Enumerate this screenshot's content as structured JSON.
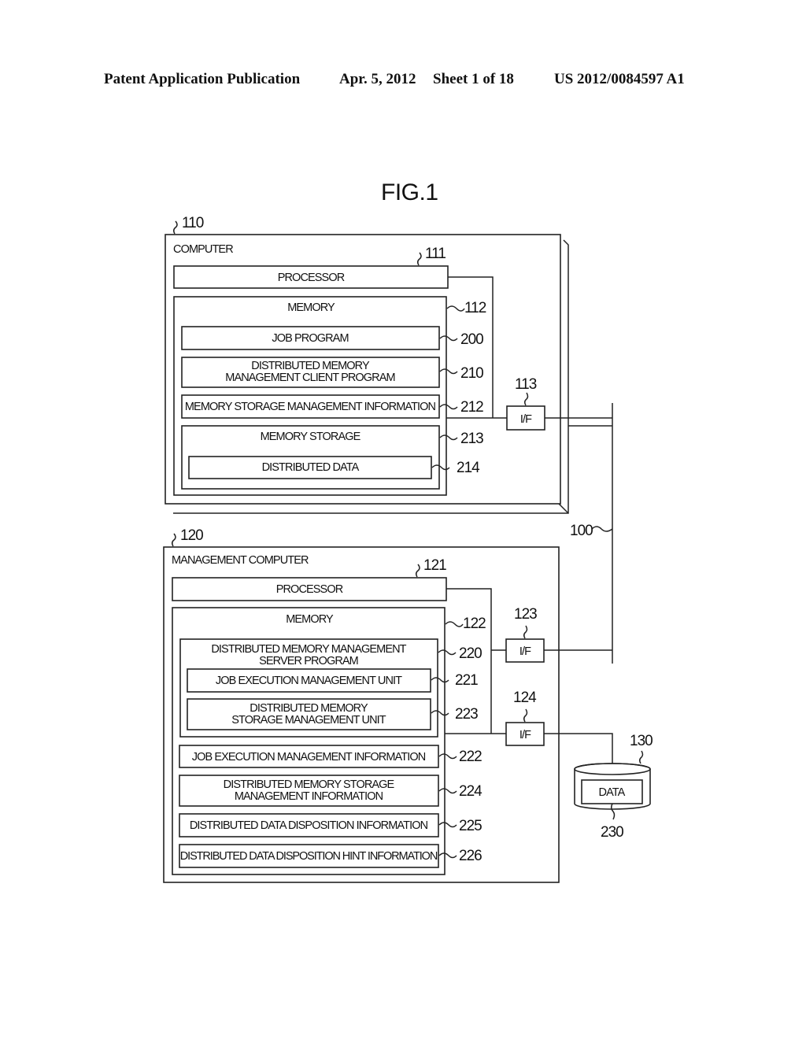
{
  "header": {
    "publication": "Patent Application Publication",
    "date": "Apr. 5, 2012",
    "sheet": "Sheet 1 of 18",
    "number": "US 2012/0084597 A1"
  },
  "figure": {
    "title": "FIG.1",
    "network_ref": "100",
    "computer": {
      "ref": "110",
      "title": "COMPUTER",
      "processor": {
        "ref": "111",
        "label": "PROCESSOR"
      },
      "memory": {
        "ref": "112",
        "label": "MEMORY",
        "items": [
          {
            "ref": "200",
            "lines": [
              "JOB PROGRAM"
            ]
          },
          {
            "ref": "210",
            "lines": [
              "DISTRIBUTED MEMORY",
              "MANAGEMENT CLIENT PROGRAM"
            ]
          },
          {
            "ref": "212",
            "lines": [
              "MEMORY STORAGE MANAGEMENT INFORMATION"
            ]
          }
        ],
        "storage": {
          "ref": "213",
          "label": "MEMORY STORAGE",
          "data": {
            "ref": "214",
            "label": "DISTRIBUTED DATA"
          }
        }
      },
      "interface": {
        "ref": "113",
        "label": "I/F"
      }
    },
    "management_computer": {
      "ref": "120",
      "title": "MANAGEMENT COMPUTER",
      "processor": {
        "ref": "121",
        "label": "PROCESSOR"
      },
      "memory": {
        "ref": "122",
        "label": "MEMORY",
        "server_program": {
          "ref": "220",
          "lines": [
            "DISTRIBUTED MEMORY MANAGEMENT",
            "SERVER PROGRAM"
          ],
          "units": [
            {
              "ref": "221",
              "lines": [
                "JOB EXECUTION MANAGEMENT UNIT"
              ]
            },
            {
              "ref": "223",
              "lines": [
                "DISTRIBUTED MEMORY",
                "STORAGE MANAGEMENT UNIT"
              ]
            }
          ]
        },
        "items": [
          {
            "ref": "222",
            "lines": [
              "JOB EXECUTION MANAGEMENT INFORMATION"
            ]
          },
          {
            "ref": "224",
            "lines": [
              "DISTRIBUTED MEMORY STORAGE",
              "MANAGEMENT INFORMATION"
            ]
          },
          {
            "ref": "225",
            "lines": [
              "DISTRIBUTED DATA DISPOSITION INFORMATION"
            ]
          },
          {
            "ref": "226",
            "lines": [
              "DISTRIBUTED DATA DISPOSITION HINT INFORMATION"
            ]
          }
        ]
      },
      "interfaces": [
        {
          "ref": "123",
          "label": "I/F"
        },
        {
          "ref": "124",
          "label": "I/F"
        }
      ]
    },
    "storage_device": {
      "ref": "130",
      "data": {
        "ref": "230",
        "label": "DATA"
      }
    }
  }
}
